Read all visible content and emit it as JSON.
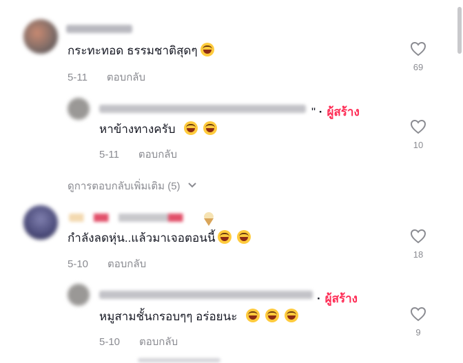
{
  "comments": [
    {
      "text": "กระทะทอด ธรรมชาติสุดๆ",
      "date": "5-11",
      "reply": "ตอบกลับ",
      "likes": "69",
      "emoji_count": 1
    },
    {
      "creator": "ผู้สร้าง",
      "text": "หาข้างทางครับ",
      "date": "5-11",
      "reply": "ตอบกลับ",
      "likes": "10",
      "emoji_count": 2
    },
    {
      "text": "กำลังลดหุ่น..แล้วมาเจอตอนนี้",
      "date": "5-10",
      "reply": "ตอบกลับ",
      "likes": "18",
      "emoji_count": 2
    },
    {
      "creator": "ผู้สร้าง",
      "text": "หมูสามชั้นกรอบๆๆ อร่อยนะ",
      "date": "5-10",
      "reply": "ตอบกลับ",
      "likes": "9",
      "emoji_count": 3
    }
  ],
  "view_more_replies": "ดูการตอบกลับเพิ่มเติม (5)",
  "icons": {
    "like": "heart-outline-icon",
    "emoji": "laughing-emoji-icon",
    "expand": "chevron-down-icon"
  },
  "colors": {
    "creator_badge": "#fe2c55",
    "meta_text": "#8a8b91"
  }
}
